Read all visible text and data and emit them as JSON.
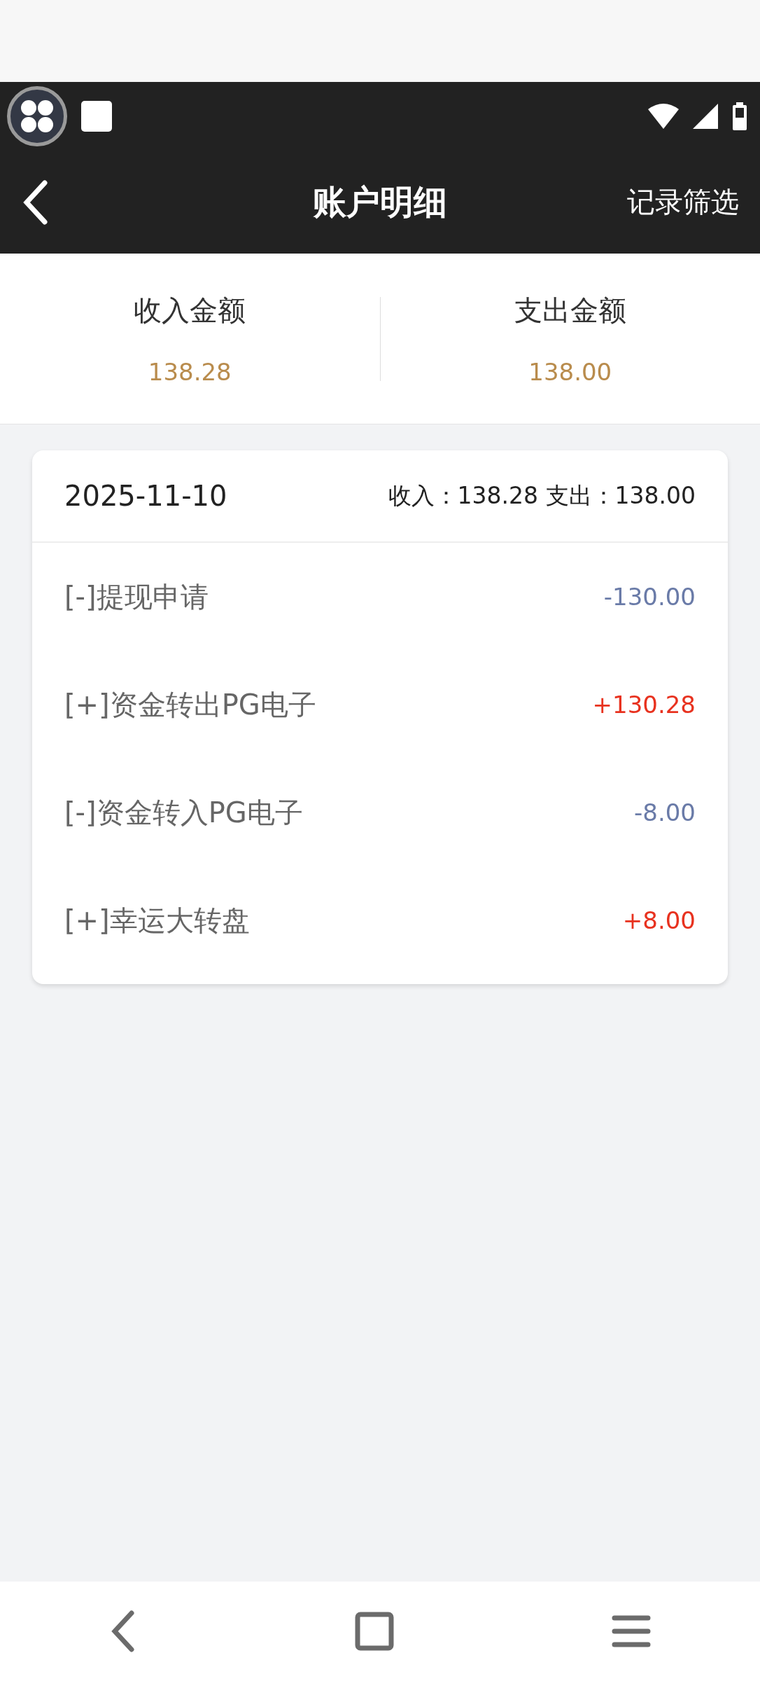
{
  "header": {
    "title": "账户明细",
    "action": "记录筛选"
  },
  "summary": [
    {
      "label": "收入金额",
      "value": "138.28"
    },
    {
      "label": "支出金额",
      "value": "138.00"
    }
  ],
  "day": {
    "date": "2025-11-10",
    "totals": "收入：138.28 支出：138.00",
    "entries": [
      {
        "label": "[-]提现申请",
        "amount": "-130.00",
        "kind": "expense"
      },
      {
        "label": "[+]资金转出PG电子",
        "amount": "+130.28",
        "kind": "income"
      },
      {
        "label": "[-]资金转入PG电子",
        "amount": "-8.00",
        "kind": "expense"
      },
      {
        "label": "[+]幸运大转盘",
        "amount": "+8.00",
        "kind": "income"
      }
    ]
  }
}
